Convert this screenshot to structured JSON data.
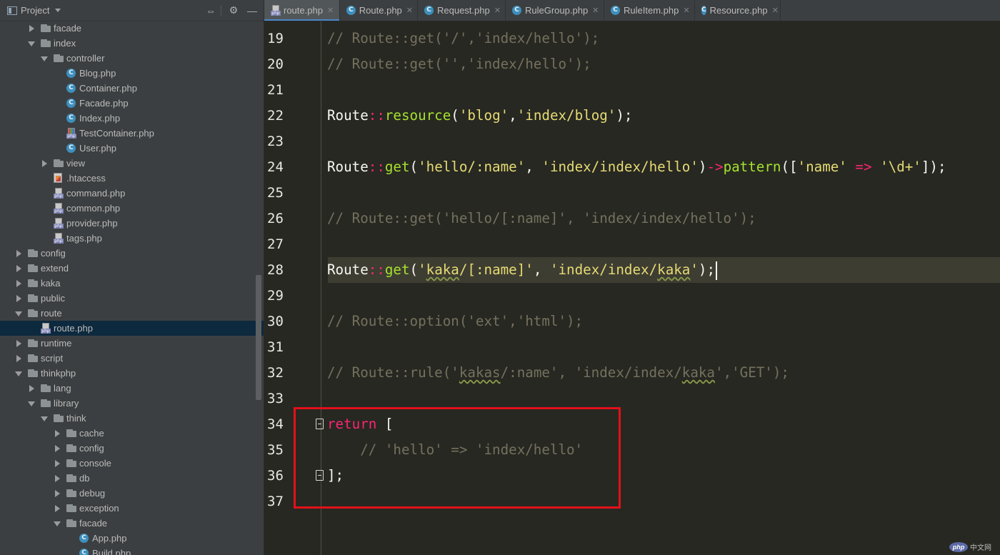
{
  "sidebar": {
    "title": "Project",
    "tree": [
      {
        "label": "facade",
        "type": "folder",
        "depth": 1,
        "state": "collapsed"
      },
      {
        "label": "index",
        "type": "folder",
        "depth": 1,
        "state": "expanded"
      },
      {
        "label": "controller",
        "type": "folder",
        "depth": 2,
        "state": "expanded"
      },
      {
        "label": "Blog.php",
        "type": "class",
        "depth": 3
      },
      {
        "label": "Container.php",
        "type": "class",
        "depth": 3
      },
      {
        "label": "Facade.php",
        "type": "class",
        "depth": 3
      },
      {
        "label": "Index.php",
        "type": "class",
        "depth": 3
      },
      {
        "label": "TestContainer.php",
        "type": "php-multi",
        "depth": 3
      },
      {
        "label": "User.php",
        "type": "class",
        "depth": 3
      },
      {
        "label": "view",
        "type": "folder",
        "depth": 2,
        "state": "collapsed"
      },
      {
        "label": ".htaccess",
        "type": "htaccess",
        "depth": 2
      },
      {
        "label": "command.php",
        "type": "php",
        "depth": 2
      },
      {
        "label": "common.php",
        "type": "php",
        "depth": 2
      },
      {
        "label": "provider.php",
        "type": "php",
        "depth": 2
      },
      {
        "label": "tags.php",
        "type": "php",
        "depth": 2
      },
      {
        "label": "config",
        "type": "folder",
        "depth": 0,
        "state": "collapsed"
      },
      {
        "label": "extend",
        "type": "folder",
        "depth": 0,
        "state": "collapsed"
      },
      {
        "label": "kaka",
        "type": "folder",
        "depth": 0,
        "state": "collapsed"
      },
      {
        "label": "public",
        "type": "folder",
        "depth": 0,
        "state": "collapsed"
      },
      {
        "label": "route",
        "type": "folder",
        "depth": 0,
        "state": "expanded"
      },
      {
        "label": "route.php",
        "type": "php",
        "depth": 1,
        "selected": true
      },
      {
        "label": "runtime",
        "type": "folder",
        "depth": 0,
        "state": "collapsed"
      },
      {
        "label": "script",
        "type": "folder",
        "depth": 0,
        "state": "collapsed"
      },
      {
        "label": "thinkphp",
        "type": "folder",
        "depth": 0,
        "state": "expanded"
      },
      {
        "label": "lang",
        "type": "folder",
        "depth": 1,
        "state": "collapsed"
      },
      {
        "label": "library",
        "type": "folder",
        "depth": 1,
        "state": "expanded"
      },
      {
        "label": "think",
        "type": "folder",
        "depth": 2,
        "state": "expanded"
      },
      {
        "label": "cache",
        "type": "folder",
        "depth": 3,
        "state": "collapsed"
      },
      {
        "label": "config",
        "type": "folder",
        "depth": 3,
        "state": "collapsed"
      },
      {
        "label": "console",
        "type": "folder",
        "depth": 3,
        "state": "collapsed"
      },
      {
        "label": "db",
        "type": "folder",
        "depth": 3,
        "state": "collapsed"
      },
      {
        "label": "debug",
        "type": "folder",
        "depth": 3,
        "state": "collapsed"
      },
      {
        "label": "exception",
        "type": "folder",
        "depth": 3,
        "state": "collapsed"
      },
      {
        "label": "facade",
        "type": "folder",
        "depth": 3,
        "state": "expanded"
      },
      {
        "label": "App.php",
        "type": "class",
        "depth": 4
      },
      {
        "label": "Build.php",
        "type": "class",
        "depth": 4
      }
    ]
  },
  "tabs": [
    {
      "label": "route.php",
      "icon": "php-file-icon",
      "active": true
    },
    {
      "label": "Route.php",
      "icon": "class-icon",
      "active": false
    },
    {
      "label": "Request.php",
      "icon": "class-icon",
      "active": false
    },
    {
      "label": "RuleGroup.php",
      "icon": "class-icon",
      "active": false
    },
    {
      "label": "RuleItem.php",
      "icon": "class-icon",
      "active": false
    },
    {
      "label": "Resource.php",
      "icon": "class-icon",
      "active": false
    }
  ],
  "editor": {
    "caret_line": 28,
    "lines": [
      {
        "n": "19",
        "tokens": [
          [
            "c",
            "// Route::get('/','index/hello');"
          ]
        ]
      },
      {
        "n": "20",
        "tokens": [
          [
            "c",
            "// Route::get('','index/hello');"
          ]
        ]
      },
      {
        "n": "21",
        "tokens": []
      },
      {
        "n": "22",
        "tokens": [
          [
            "t",
            "Route"
          ],
          [
            "o",
            "::"
          ],
          [
            "f",
            "resource"
          ],
          [
            "t",
            "("
          ],
          [
            "s",
            "'blog'"
          ],
          [
            "t",
            ","
          ],
          [
            "s",
            "'index/blog'"
          ],
          [
            "t",
            ");"
          ]
        ]
      },
      {
        "n": "23",
        "tokens": []
      },
      {
        "n": "24",
        "tokens": [
          [
            "t",
            "Route"
          ],
          [
            "o",
            "::"
          ],
          [
            "f",
            "get"
          ],
          [
            "t",
            "("
          ],
          [
            "s",
            "'hello/:name'"
          ],
          [
            "t",
            ", "
          ],
          [
            "s",
            "'index/index/hello'"
          ],
          [
            "t",
            ")"
          ],
          [
            "o",
            "->"
          ],
          [
            "f",
            "pattern"
          ],
          [
            "t",
            "(["
          ],
          [
            "s",
            "'name'"
          ],
          [
            "t",
            " "
          ],
          [
            "o",
            "=>"
          ],
          [
            "t",
            " "
          ],
          [
            "s",
            "'\\d+'"
          ],
          [
            "t",
            "]);"
          ]
        ]
      },
      {
        "n": "25",
        "tokens": []
      },
      {
        "n": "26",
        "tokens": [
          [
            "c",
            "// Route::get('hello/[:name]', 'index/index/hello');"
          ]
        ]
      },
      {
        "n": "27",
        "tokens": []
      },
      {
        "n": "28",
        "tokens": [
          [
            "t",
            "Route"
          ],
          [
            "o",
            "::"
          ],
          [
            "f",
            "get"
          ],
          [
            "t",
            "("
          ],
          [
            "s",
            "'"
          ],
          [
            "sw",
            "kaka"
          ],
          [
            "s",
            "/[:name]'"
          ],
          [
            "t",
            ", "
          ],
          [
            "s",
            "'index/index/"
          ],
          [
            "sw",
            "kaka"
          ],
          [
            "s",
            "'"
          ],
          [
            "t",
            ");"
          ]
        ],
        "cursor": true
      },
      {
        "n": "29",
        "tokens": []
      },
      {
        "n": "30",
        "tokens": [
          [
            "c",
            "// Route::option('ext','html');"
          ]
        ]
      },
      {
        "n": "31",
        "tokens": []
      },
      {
        "n": "32",
        "tokens": [
          [
            "c",
            "// Route::rule('"
          ],
          [
            "cw",
            "kakas"
          ],
          [
            "c",
            "/:name', 'index/index/"
          ],
          [
            "cw",
            "kaka"
          ],
          [
            "c",
            "','GET');"
          ]
        ]
      },
      {
        "n": "33",
        "tokens": []
      },
      {
        "n": "34",
        "tokens": [
          [
            "k",
            "return"
          ],
          [
            "t",
            " ["
          ]
        ],
        "fold": true
      },
      {
        "n": "35",
        "tokens": [
          [
            "c",
            "    // 'hello' => 'index/hello'"
          ]
        ]
      },
      {
        "n": "36",
        "tokens": [
          [
            "t",
            "];"
          ]
        ],
        "fold": true
      },
      {
        "n": "37",
        "tokens": []
      }
    ]
  },
  "watermark": {
    "logo": "php",
    "text": "中文网"
  },
  "colors": {
    "highlight_box": "#e3101a",
    "selection": "#0d293e",
    "active_tab_underline": "#4a88c7"
  }
}
